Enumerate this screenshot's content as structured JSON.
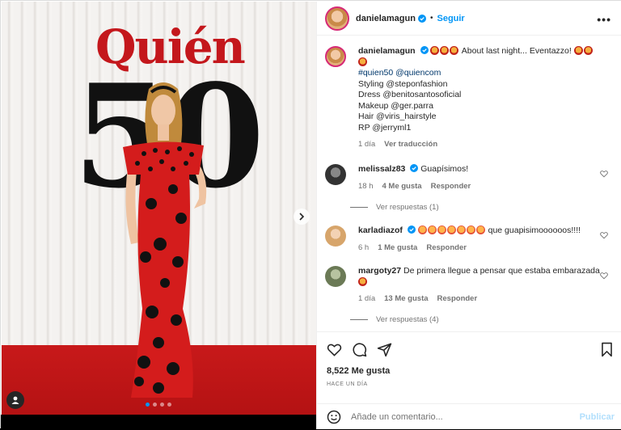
{
  "post": {
    "username": "danielamagun",
    "separator": "•",
    "follow_label": "Seguir",
    "more_label": "•••",
    "photo_text_top": "Quién",
    "photo_text_bottom": "50",
    "carousel": {
      "current": 1,
      "total": 4
    }
  },
  "caption": {
    "username": "danielamagun",
    "text": "About last night... Eventazzo!",
    "lines": [
      "#quien50 @quiencom",
      "Styling @steponfashion",
      "Dress @benitosantosoficial",
      "Makeup @ger.parra",
      "Hair @viris_hairstyle",
      "RP @jerryml1"
    ],
    "time": "1 día",
    "translate": "Ver traducción"
  },
  "comments": [
    {
      "username": "melissalz83",
      "text": "Guapísimos!",
      "time": "18 h",
      "likes": "4 Me gusta",
      "reply": "Responder",
      "view_replies": "Ver respuestas (1)"
    },
    {
      "username": "karladiazof",
      "text": "que guapisimoooooos!!!!",
      "time": "6 h",
      "likes": "1 Me gusta",
      "reply": "Responder"
    },
    {
      "username": "margoty27",
      "text": "De primera llegue a pensar que estaba embarazada",
      "time": "1 día",
      "likes": "13 Me gusta",
      "reply": "Responder",
      "view_replies": "Ver respuestas (4)"
    }
  ],
  "footer": {
    "likes": "8,522 Me gusta",
    "ago": "HACE UN DÍA",
    "comment_placeholder": "Añade un comentario...",
    "publish": "Publicar"
  },
  "colors": {
    "accent": "#0095f6",
    "publish_disabled": "#b2dffc",
    "dress": "#d41c1c"
  }
}
